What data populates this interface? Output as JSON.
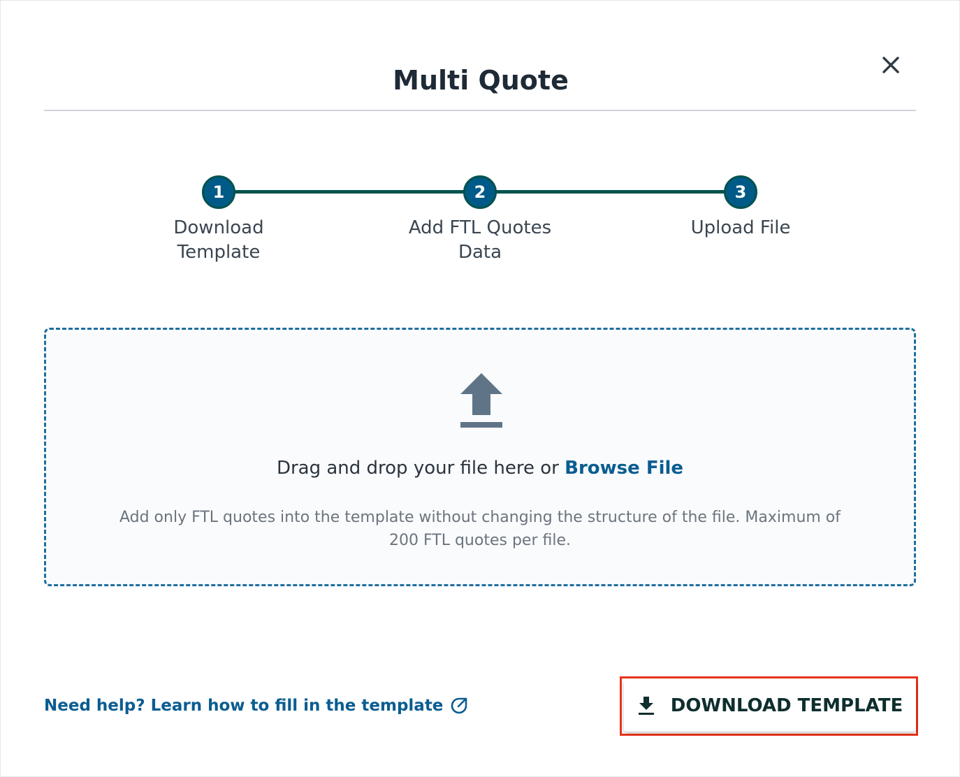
{
  "dialog": {
    "title": "Multi Quote",
    "close_icon": "close-icon"
  },
  "stepper": {
    "steps": [
      {
        "number": "1",
        "label_line1": "Download",
        "label_line2": "Template"
      },
      {
        "number": "2",
        "label_line1": "Add FTL Quotes",
        "label_line2": "Data"
      },
      {
        "number": "3",
        "label_line1": "Upload File",
        "label_line2": ""
      }
    ],
    "active_color": "#005a87",
    "line_color": "#03524f"
  },
  "dropzone": {
    "icon": "upload-icon",
    "text": "Drag and drop your file here or ",
    "browse_label": "Browse File",
    "hint": "Add only FTL quotes into the template without changing the structure of the file. Maximum of 200 FTL quotes per file.",
    "border_color": "#1f6e9e"
  },
  "footer": {
    "help_label": "Need help? Learn how to fill in the template",
    "help_icon": "external-link-icon",
    "download_label": "DOWNLOAD TEMPLATE",
    "download_icon": "download-icon",
    "highlight_color": "#e8321b"
  }
}
